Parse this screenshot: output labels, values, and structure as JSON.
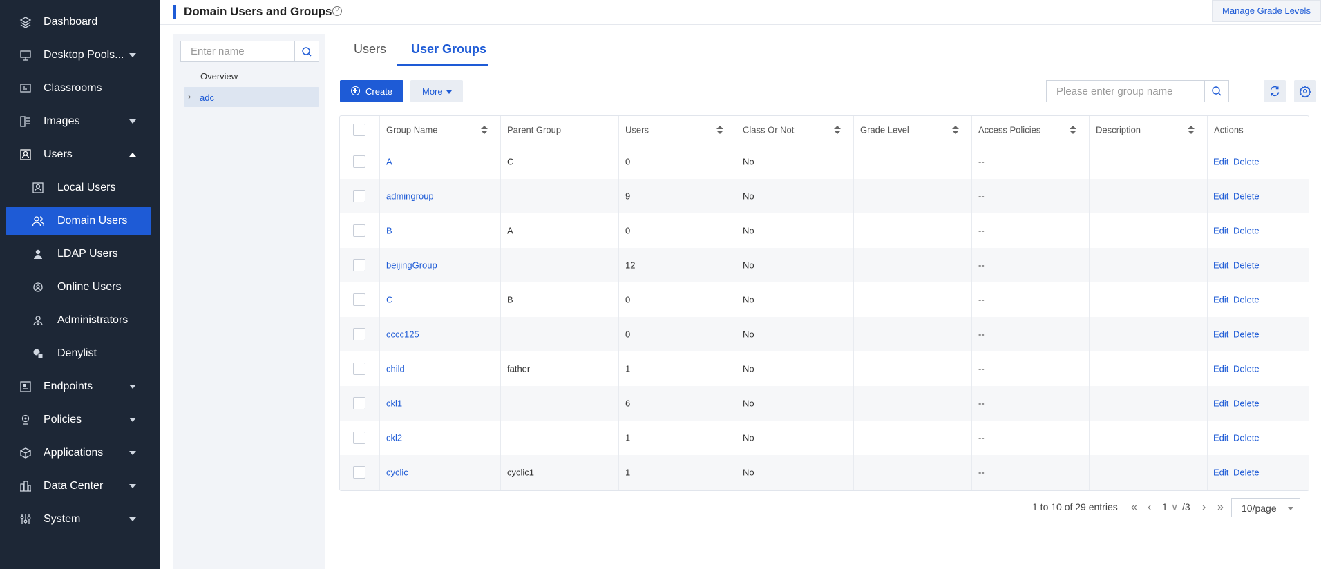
{
  "sidebar": {
    "items": [
      {
        "label": "Dashboard",
        "icon": "layers-icon",
        "has_caret": false
      },
      {
        "label": "Desktop Pools...",
        "icon": "desktop-icon",
        "has_caret": true
      },
      {
        "label": "Classrooms",
        "icon": "classroom-icon",
        "has_caret": false
      },
      {
        "label": "Images",
        "icon": "images-icon",
        "has_caret": true
      },
      {
        "label": "Users",
        "icon": "users-icon",
        "has_caret": true,
        "expanded": true
      },
      {
        "label": "Local Users",
        "icon": "local-user-icon",
        "sub": true
      },
      {
        "label": "Domain Users",
        "icon": "domain-users-icon",
        "sub": true,
        "active": true
      },
      {
        "label": "LDAP Users",
        "icon": "ldap-user-icon",
        "sub": true
      },
      {
        "label": "Online Users",
        "icon": "online-user-icon",
        "sub": true
      },
      {
        "label": "Administrators",
        "icon": "admin-icon",
        "sub": true
      },
      {
        "label": "Denylist",
        "icon": "denylist-icon",
        "sub": true
      },
      {
        "label": "Endpoints",
        "icon": "endpoints-icon",
        "has_caret": true
      },
      {
        "label": "Policies",
        "icon": "policies-icon",
        "has_caret": true
      },
      {
        "label": "Applications",
        "icon": "applications-icon",
        "has_caret": true
      },
      {
        "label": "Data Center",
        "icon": "datacenter-icon",
        "has_caret": true
      },
      {
        "label": "System",
        "icon": "system-icon",
        "has_caret": true
      }
    ]
  },
  "header": {
    "title": "Domain Users and Groups",
    "help_glyph": "?",
    "manage_button": "Manage Grade Levels"
  },
  "tree": {
    "search_placeholder": "Enter name",
    "overview": "Overview",
    "node_label": "adc",
    "node_arrow": "›"
  },
  "tabs": [
    {
      "label": "Users",
      "active": false
    },
    {
      "label": "User Groups",
      "active": true
    }
  ],
  "toolbar": {
    "create_label": "Create",
    "more_label": "More",
    "search_placeholder": "Please enter group name"
  },
  "table": {
    "columns": [
      "Group Name",
      "Parent Group",
      "Users",
      "Class Or Not",
      "Grade Level",
      "Access Policies",
      "Description",
      "Actions"
    ],
    "edit_label": "Edit",
    "delete_label": "Delete",
    "rows": [
      {
        "name": "A",
        "parent": "C",
        "users": "0",
        "class": "No",
        "grade": "",
        "policies": "--",
        "desc": ""
      },
      {
        "name": "admingroup",
        "parent": "",
        "users": "9",
        "class": "No",
        "grade": "",
        "policies": "--",
        "desc": ""
      },
      {
        "name": "B",
        "parent": "A",
        "users": "0",
        "class": "No",
        "grade": "",
        "policies": "--",
        "desc": ""
      },
      {
        "name": "beijingGroup",
        "parent": "",
        "users": "12",
        "class": "No",
        "grade": "",
        "policies": "--",
        "desc": ""
      },
      {
        "name": "C",
        "parent": "B",
        "users": "0",
        "class": "No",
        "grade": "",
        "policies": "--",
        "desc": ""
      },
      {
        "name": "cccc125",
        "parent": "",
        "users": "0",
        "class": "No",
        "grade": "",
        "policies": "--",
        "desc": ""
      },
      {
        "name": "child",
        "parent": "father",
        "users": "1",
        "class": "No",
        "grade": "",
        "policies": "--",
        "desc": ""
      },
      {
        "name": "ckl1",
        "parent": "",
        "users": "6",
        "class": "No",
        "grade": "",
        "policies": "--",
        "desc": ""
      },
      {
        "name": "ckl2",
        "parent": "",
        "users": "1",
        "class": "No",
        "grade": "",
        "policies": "--",
        "desc": ""
      },
      {
        "name": "cyclic",
        "parent": "cyclic1",
        "users": "1",
        "class": "No",
        "grade": "",
        "policies": "--",
        "desc": ""
      }
    ]
  },
  "pagination": {
    "summary": "1 to 10 of 29 entries",
    "first": "«",
    "prev": "‹",
    "current_page": "1",
    "page_dropdown": "∨",
    "total_pages": "/3",
    "next": "›",
    "last": "»",
    "per_page": "10/page"
  },
  "colors": {
    "sidebar_bg": "#1d2736",
    "accent": "#1e5bd6"
  }
}
